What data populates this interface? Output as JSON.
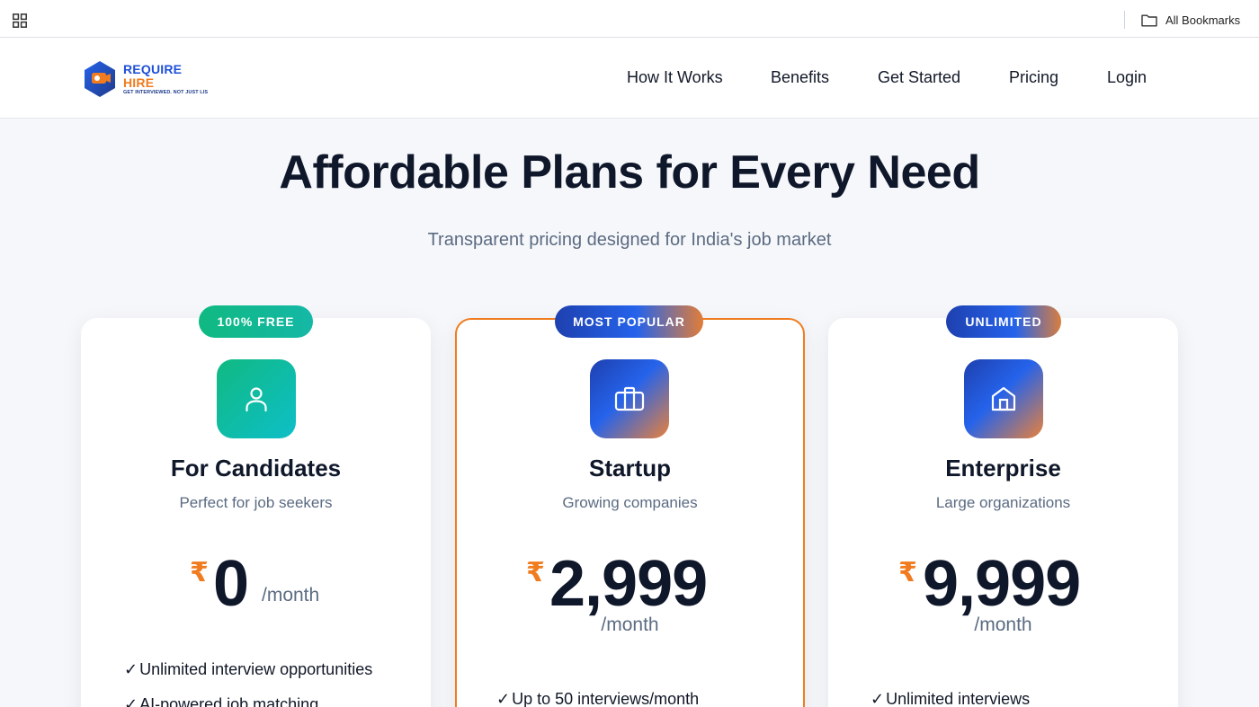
{
  "browser": {
    "all_bookmarks": "All Bookmarks",
    "apps_icon": "apps-grid-icon",
    "folder_icon": "folder-icon"
  },
  "header": {
    "logo": {
      "line1": "REQUIRE",
      "line2": "HIRE",
      "tagline": "GET INTERVIEWED. NOT JUST LIS"
    },
    "nav": [
      "How It Works",
      "Benefits",
      "Get Started",
      "Pricing",
      "Login"
    ]
  },
  "hero": {
    "title": "Affordable Plans for Every Need",
    "subtitle": "Transparent pricing designed for India's job market"
  },
  "plans": [
    {
      "badge": "100% FREE",
      "icon": "user-icon",
      "title": "For Candidates",
      "subtitle": "Perfect for job seekers",
      "currency": "₹",
      "price": "0",
      "period": "/month",
      "features": [
        "Unlimited interview opportunities",
        "AI-powered job matching"
      ]
    },
    {
      "badge": "MOST POPULAR",
      "icon": "briefcase-icon",
      "title": "Startup",
      "subtitle": "Growing companies",
      "currency": "₹",
      "price": "2,999",
      "period": "/month",
      "features": [
        "Up to 50 interviews/month"
      ]
    },
    {
      "badge": "UNLIMITED",
      "icon": "building-icon",
      "title": "Enterprise",
      "subtitle": "Large organizations",
      "currency": "₹",
      "price": "9,999",
      "period": "/month",
      "features": [
        "Unlimited interviews"
      ]
    }
  ],
  "check_mark": "✓",
  "colors": {
    "accent_orange": "#f07c1f",
    "brand_blue": "#1e4fd8",
    "free_green": "#10b981",
    "text_dark": "#0f172a",
    "text_muted": "#5b6b82"
  }
}
